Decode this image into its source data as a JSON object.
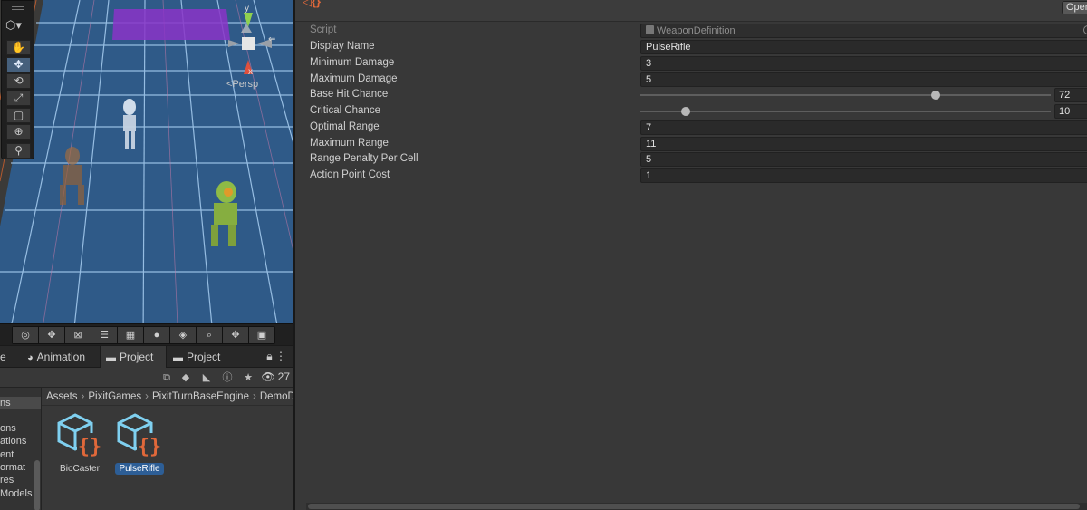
{
  "scene": {
    "persp_label": "Persp",
    "gizmo_axes": {
      "y": "y",
      "x": "x"
    },
    "tools": [
      {
        "name": "hand",
        "glyph": "✋"
      },
      {
        "name": "move",
        "glyph": "✥"
      },
      {
        "name": "rotate",
        "glyph": "⟲"
      },
      {
        "name": "scale",
        "glyph": "⤢"
      },
      {
        "name": "rect",
        "glyph": "▢"
      },
      {
        "name": "transform",
        "glyph": "⊕"
      },
      {
        "name": "custom",
        "glyph": "⚲"
      }
    ],
    "toolbar_icons": [
      "◎",
      "✥",
      "⊠",
      "☰",
      "▦",
      "●",
      "◈",
      "⌕",
      "✥",
      "▣"
    ]
  },
  "project": {
    "tabs": {
      "hierarchy_partial": "e",
      "animation": "Animation",
      "project1": "Project",
      "project2": "Project"
    },
    "visible_count": "27",
    "breadcrumb": [
      "Assets",
      "PixitGames",
      "PixitTurnBaseEngine",
      "DemoD"
    ],
    "tree_items": [
      "ns",
      "",
      "ons",
      "ations",
      "ent",
      "ormat",
      "res",
      "Models"
    ],
    "assets": [
      {
        "name": "BioCaster",
        "selected": false
      },
      {
        "name": "PulseRifle",
        "selected": true
      }
    ]
  },
  "inspector": {
    "open_button": "Open",
    "script": {
      "label": "Script",
      "value": "WeaponDefinition"
    },
    "display_name": {
      "label": "Display Name",
      "value": "PulseRifle"
    },
    "minimum_damage": {
      "label": "Minimum Damage",
      "value": "3"
    },
    "maximum_damage": {
      "label": "Maximum Damage",
      "value": "5"
    },
    "base_hit_chance": {
      "label": "Base Hit Chance",
      "value": "72",
      "fraction": 0.72
    },
    "critical_chance": {
      "label": "Critical Chance",
      "value": "10",
      "fraction": 0.11
    },
    "optimal_range": {
      "label": "Optimal Range",
      "value": "7"
    },
    "maximum_range": {
      "label": "Maximum Range",
      "value": "11"
    },
    "range_penalty": {
      "label": "Range Penalty Per Cell",
      "value": "5"
    },
    "action_point_cost": {
      "label": "Action Point Cost",
      "value": "1"
    }
  },
  "colors": {
    "accent_selection": "#2d5e96",
    "asset_brace": "#e0683a",
    "asset_cube": "#7fd0f0"
  }
}
